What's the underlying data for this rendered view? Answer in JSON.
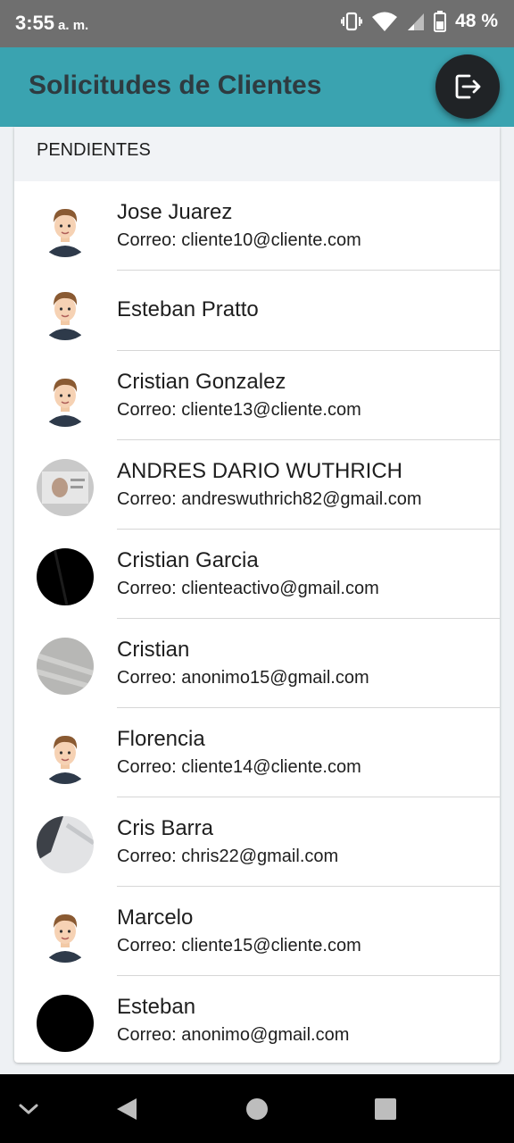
{
  "status_bar": {
    "time": "3:55",
    "ampm": "a. m.",
    "battery": "48 %",
    "icons": [
      "vibrate-icon",
      "wifi-icon",
      "signal-icon",
      "battery-icon"
    ]
  },
  "app_bar": {
    "title": "Solicitudes de Clientes",
    "logout_icon": "logout-icon",
    "color": "#3aa3b0"
  },
  "section": {
    "title": "PENDIENTES"
  },
  "clients": [
    {
      "name": "Jose Juarez",
      "email": "Correo: cliente10@cliente.com",
      "avatar": "cartoon"
    },
    {
      "name": "Esteban Pratto",
      "email": "",
      "avatar": "cartoon"
    },
    {
      "name": "Cristian Gonzalez",
      "email": "Correo: cliente13@cliente.com",
      "avatar": "cartoon"
    },
    {
      "name": "ANDRES DARIO WUTHRICH",
      "email": "Correo: andreswuthrich82@gmail.com",
      "avatar": "photo-id"
    },
    {
      "name": "Cristian Garcia",
      "email": "Correo: clienteactivo@gmail.com",
      "avatar": "photo-dark"
    },
    {
      "name": "Cristian",
      "email": "Correo: anonimo15@gmail.com",
      "avatar": "photo-gray"
    },
    {
      "name": "Florencia",
      "email": "Correo: cliente14@cliente.com",
      "avatar": "cartoon"
    },
    {
      "name": "Cris Barra",
      "email": "Correo: chris22@gmail.com",
      "avatar": "photo-light"
    },
    {
      "name": "Marcelo",
      "email": "Correo: cliente15@cliente.com",
      "avatar": "cartoon"
    },
    {
      "name": "Esteban",
      "email": "Correo: anonimo@gmail.com",
      "avatar": "photo-black"
    }
  ],
  "nav_bar": {
    "buttons": [
      "chevron-down-icon",
      "back-icon",
      "home-icon",
      "recents-icon"
    ]
  }
}
